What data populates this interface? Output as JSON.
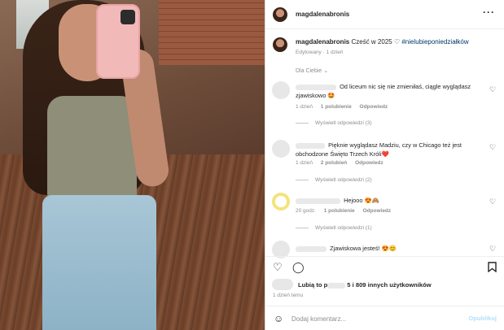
{
  "post": {
    "username": "magdalenabronis",
    "caption_text": "Cześć w 2025 ♡",
    "caption_hashtag": "#nielubieponiedziałków",
    "edited": "Edytowany",
    "age": "1 dzień"
  },
  "comments_section": {
    "filter_label": "Dla Ciebie ⌄"
  },
  "comments": [
    {
      "text": "Od liceum nic się nie zmieniłaś, ciągle wyglądasz zjawiskowo 🤩",
      "age": "1 dzień",
      "likes": "1 polubienie",
      "reply": "Odpowiedz",
      "view_replies": "Wyświetl odpowiedzi (3)"
    },
    {
      "text": "Pięknie wyglądasz Madziu, czy w Chicago też jest obchodzone Święto Trzech Króli❤️",
      "age": "1 dzień",
      "likes": "2 polubień",
      "reply": "Odpowiedz",
      "view_replies": "Wyświetl odpowiedzi (2)"
    },
    {
      "text": "Hejooo 😍🙈",
      "age": "20 godz.",
      "likes": "1 polubienie",
      "reply": "Odpowiedz",
      "view_replies": "Wyświetl odpowiedzi (1)"
    },
    {
      "text": "Zjawiskowa jesteś! 😍😊",
      "age": "",
      "likes": "",
      "reply": "",
      "view_replies": ""
    }
  ],
  "likes": {
    "prefix": "Lubią to",
    "masked": "p",
    "suffix": "5 i 809 innych użytkowników"
  },
  "timestamp": "1 dzień temu",
  "composer": {
    "placeholder": "Dodaj komentarz...",
    "post_label": "Opublikuj"
  },
  "icons": {
    "more": "more-horizontal-icon",
    "heart": "heart-icon",
    "comment": "comment-icon",
    "save": "bookmark-icon",
    "emoji": "emoji-icon"
  },
  "colors": {
    "link": "#00376b",
    "muted": "#8e8e8e",
    "post_disabled": "#b2dffc"
  }
}
